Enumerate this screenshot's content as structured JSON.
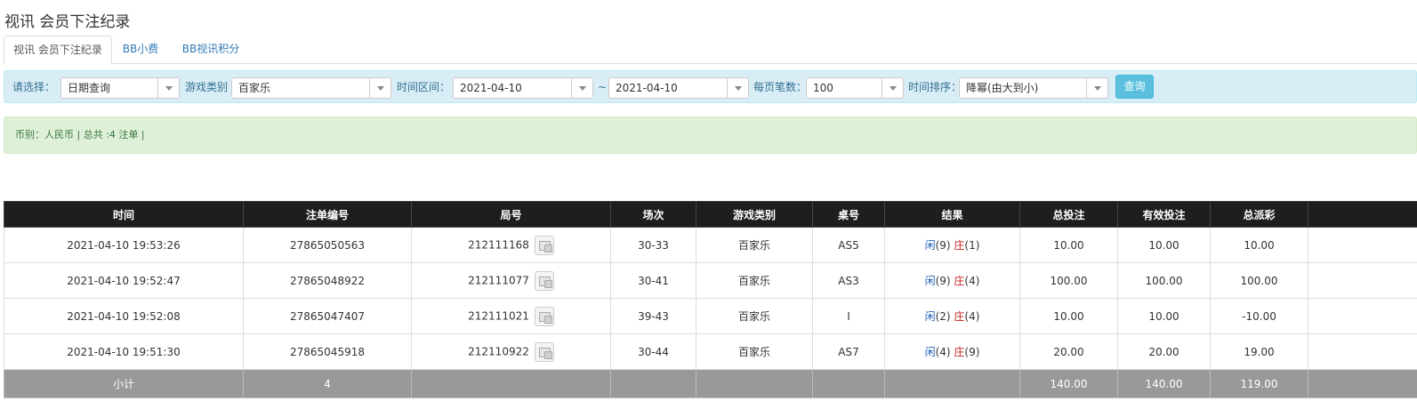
{
  "page_title": "视讯 会员下注纪录",
  "tabs": [
    {
      "label": "视讯 会员下注纪录",
      "active": true
    },
    {
      "label": "BB小费",
      "active": false
    },
    {
      "label": "BB视讯积分",
      "active": false
    }
  ],
  "filters": {
    "select_label": "请选择：",
    "select_value": "日期查询",
    "game_type_label": "游戏类别",
    "game_type_value": "百家乐",
    "time_range_label": "时间区间：",
    "date_from": "2021-04-10",
    "tilde": "~",
    "date_to": "2021-04-10",
    "per_page_label": "每页笔数：",
    "per_page_value": "100",
    "sort_label": "时间排序：",
    "sort_value": "降幂(由大到小)",
    "query_button": "查询"
  },
  "summary": "币别：人民币 | 总共 :4 注单 |",
  "table": {
    "headers": [
      "时间",
      "注单编号",
      "局号",
      "场次",
      "游戏类别",
      "桌号",
      "结果",
      "总投注",
      "有效投注",
      "总派彩",
      ""
    ],
    "rows": [
      {
        "time": "2021-04-10 19:53:26",
        "bet_id": "27865050563",
        "round": "212111168",
        "session": "30-33",
        "game": "百家乐",
        "table": "AS5",
        "player_label": "闲",
        "player_val": "(9)",
        "banker_label": "庄",
        "banker_val": "(1)",
        "total_bet": "10.00",
        "valid_bet": "10.00",
        "payout": "10.00",
        "payout_negative": false
      },
      {
        "time": "2021-04-10 19:52:47",
        "bet_id": "27865048922",
        "round": "212111077",
        "session": "30-41",
        "game": "百家乐",
        "table": "AS3",
        "player_label": "闲",
        "player_val": "(9)",
        "banker_label": "庄",
        "banker_val": "(4)",
        "total_bet": "100.00",
        "valid_bet": "100.00",
        "payout": "100.00",
        "payout_negative": false
      },
      {
        "time": "2021-04-10 19:52:08",
        "bet_id": "27865047407",
        "round": "212111021",
        "session": "39-43",
        "game": "百家乐",
        "table": "I",
        "player_label": "闲",
        "player_val": "(2)",
        "banker_label": "庄",
        "banker_val": "(4)",
        "total_bet": "10.00",
        "valid_bet": "10.00",
        "payout": "-10.00",
        "payout_negative": true
      },
      {
        "time": "2021-04-10 19:51:30",
        "bet_id": "27865045918",
        "round": "212110922",
        "session": "30-44",
        "game": "百家乐",
        "table": "AS7",
        "player_label": "闲",
        "player_val": "(4)",
        "banker_label": "庄",
        "banker_val": "(9)",
        "total_bet": "20.00",
        "valid_bet": "20.00",
        "payout": "19.00",
        "payout_negative": false
      }
    ],
    "subtotal": {
      "label": "小计",
      "count": "4",
      "total_bet": "140.00",
      "valid_bet": "140.00",
      "payout": "119.00"
    }
  },
  "colors": {
    "header_bg": "#1e1e1e",
    "filter_bg": "#d9edf7",
    "summary_bg": "#dff0d8",
    "subtotal_bg": "#999999",
    "query_button": "#5bc0de",
    "negative": "#c0101a",
    "link_blue": "#2a6fb8"
  },
  "icons": {
    "round_detail": "round-detail-icon",
    "dropdown": "chevron-down-icon"
  }
}
